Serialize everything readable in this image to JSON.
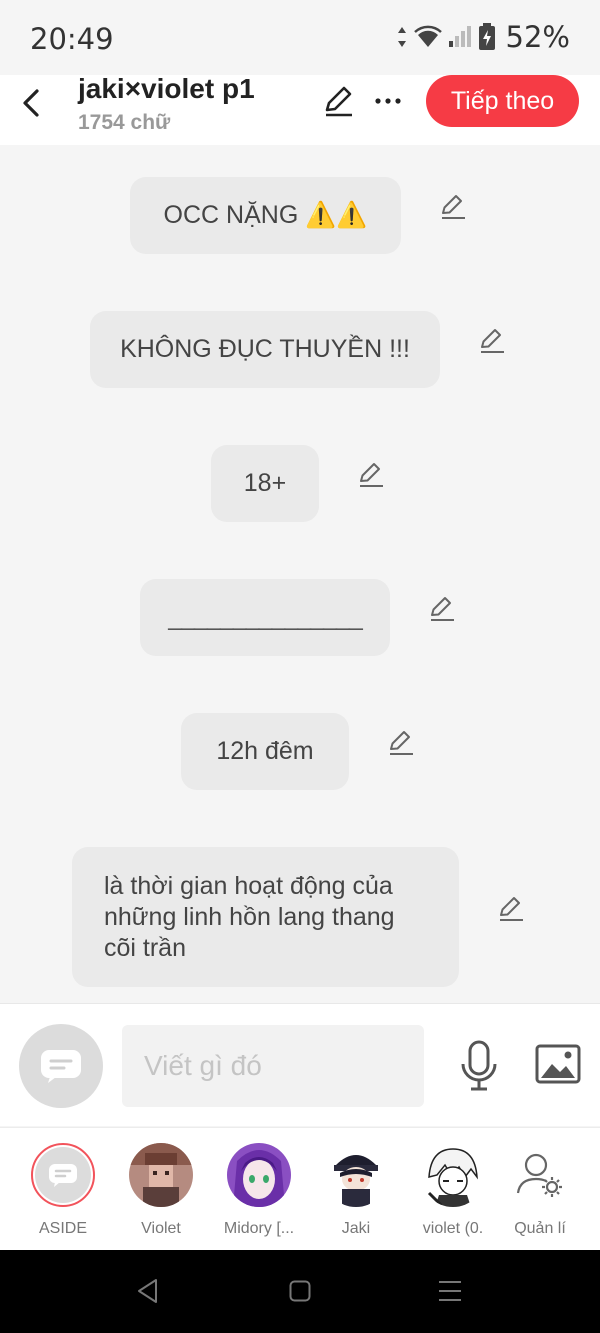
{
  "status": {
    "time": "20:49",
    "battery": "52%"
  },
  "header": {
    "title": "jaki×violet p1",
    "word_count": "1754 chữ",
    "next_label": "Tiếp theo"
  },
  "messages": [
    {
      "text": "OCC NẶNG ⚠️⚠️"
    },
    {
      "text": "KHÔNG ĐỤC THUYỀN !!!"
    },
    {
      "text": "18+"
    },
    {
      "text": "_______________"
    },
    {
      "text": "12h đêm"
    },
    {
      "text": "là thời gian hoạt động của những linh hồn lang thang cõi trần"
    }
  ],
  "input": {
    "placeholder": "Viết gì đó"
  },
  "characters": [
    {
      "label": "ASIDE"
    },
    {
      "label": "Violet"
    },
    {
      "label": "Midory [..."
    },
    {
      "label": "Jaki"
    },
    {
      "label": "violet (0."
    },
    {
      "label": "Quản lí"
    }
  ],
  "colors": {
    "accent": "#f63b45",
    "bubble": "#eaeaea",
    "background": "#f5f5f5"
  }
}
